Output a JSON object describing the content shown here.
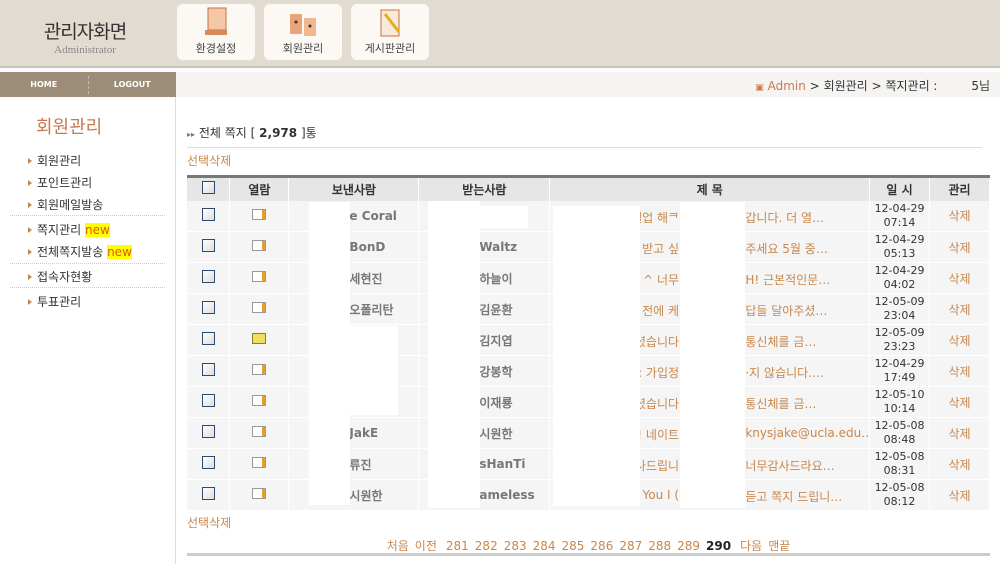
{
  "header": {
    "title": "관리자화면",
    "subtitle": "Administrator",
    "buttons": [
      {
        "label": "환경설정",
        "icon": "monitor-icon"
      },
      {
        "label": "회원관리",
        "icon": "members-icon"
      },
      {
        "label": "게시판관리",
        "icon": "board-icon"
      }
    ]
  },
  "nav": {
    "home": "HOME",
    "logout": "LOGOUT"
  },
  "sidebar": {
    "title": "회원관리",
    "items": [
      {
        "label": "회원관리"
      },
      {
        "label": "포인트관리"
      },
      {
        "label": "회원메일발송"
      },
      {
        "label": "쪽지관리",
        "badge": "new"
      },
      {
        "label": "전체쪽지발송",
        "badge": "new"
      },
      {
        "label": "접속자현황"
      },
      {
        "label": "투표관리"
      }
    ]
  },
  "breadcrumb": {
    "root": "Admin",
    "sep": ">",
    "l1": "회원관리",
    "l2": "쪽지관리 :",
    "user_suffix": "5님"
  },
  "main": {
    "total_prefix": "전체 쪽지 [",
    "total": "2,978",
    "total_suffix": "]통",
    "select_delete": "선택삭제",
    "columns": [
      "열람",
      "보낸사람",
      "받는사람",
      "제 목",
      "일 시",
      "관리"
    ],
    "rows": [
      {
        "read": "read",
        "sender": "e Coral",
        "recipient": "",
        "subject": [
          "벨업 해ᄏ",
          "갑니다. 더 열…"
        ],
        "date": "12-04-29",
        "time": "07:14",
        "action": "삭제"
      },
      {
        "read": "read",
        "sender": "BonD",
        "recipient": "Waltz",
        "subject": [
          "받고 싶",
          "주세요 5월 중…"
        ],
        "date": "12-04-29",
        "time": "05:13",
        "action": "삭제"
      },
      {
        "read": "read",
        "sender": "세현진",
        "recipient": "하늘이",
        "subject": [
          "^ 너무",
          "H! 근본적인문…"
        ],
        "date": "12-04-29",
        "time": "04:02",
        "action": "삭제"
      },
      {
        "read": "read",
        "sender": "오폴리탄",
        "recipient": "김윤환",
        "subject": [
          "전에 케",
          "답들 달아주셨…"
        ],
        "date": "12-05-09",
        "time": "23:04",
        "action": "삭제"
      },
      {
        "read": "unread",
        "sender": "",
        "recipient": "김지엽",
        "subject": [
          "셨습니다",
          "통신체를 금…"
        ],
        "date": "12-05-09",
        "time": "23:23",
        "action": "삭제"
      },
      {
        "read": "read",
        "sender": "",
        "recipient": "강봉학",
        "subject": [
          ": 가입정",
          "·지 않습니다.…"
        ],
        "date": "12-04-29",
        "time": "17:49",
        "action": "삭제"
      },
      {
        "read": "read",
        "sender": "",
        "recipient": "이재룡",
        "subject": [
          "셨습니다",
          "통신체를 금…"
        ],
        "date": "12-05-10",
        "time": "10:14",
        "action": "삭제"
      },
      {
        "read": "read",
        "sender": "JakE",
        "recipient": "시원한",
        "subject": [
          "! 네이트",
          "knysjake@ucla.edu…"
        ],
        "date": "12-05-08",
        "time": "08:48",
        "action": "삭제"
      },
      {
        "read": "read",
        "sender": "류진",
        "recipient": "sHanTi",
        "subject": [
          "사드립니",
          "너무감사드라요…"
        ],
        "date": "12-05-08",
        "time": "08:31",
        "action": "삭제"
      },
      {
        "read": "read",
        "sender": "시원한",
        "recipient": "ameless",
        "subject": [
          "You I (",
          "듣고 쪽지 드립니…"
        ],
        "date": "12-05-08",
        "time": "08:12",
        "action": "삭제"
      }
    ]
  },
  "pagination": {
    "first": "처음",
    "prev": "이전",
    "pages": [
      "281",
      "282",
      "283",
      "284",
      "285",
      "286",
      "287",
      "288",
      "289",
      "290"
    ],
    "current": "290",
    "next": "다음",
    "last": "맨끝"
  },
  "colors": {
    "accent": "#c8874e",
    "nav": "#9c8c78",
    "header": "#e2dbd2"
  }
}
